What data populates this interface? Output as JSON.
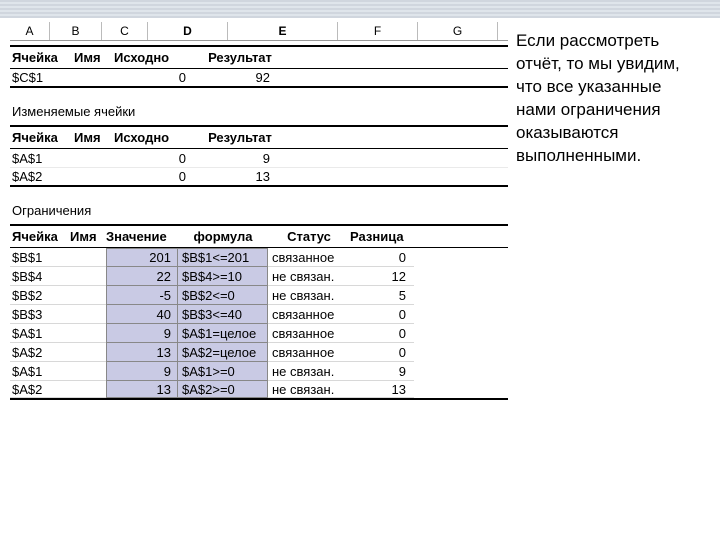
{
  "columns": {
    "a": "A",
    "b": "B",
    "c": "C",
    "d": "D",
    "e": "E",
    "f": "F",
    "g": "G"
  },
  "targetHeaders": {
    "cell": "Ячейка",
    "name": "Имя",
    "initial": "Исходно",
    "result": "Результат"
  },
  "targetRow": {
    "cell": "$C$1",
    "initial": "0",
    "result": "92"
  },
  "changingTitle": "Изменяемые ячейки",
  "changing": [
    {
      "cell": "$A$1",
      "initial": "0",
      "result": "9"
    },
    {
      "cell": "$A$2",
      "initial": "0",
      "result": "13"
    }
  ],
  "constraintsTitle": "Ограничения",
  "constraintHeaders": {
    "cell": "Ячейка",
    "name": "Имя",
    "value": "Значение",
    "formula": "формула",
    "status": "Статус",
    "diff": "Разница"
  },
  "constraints": [
    {
      "cell": "$B$1",
      "value": "201",
      "formula": "$B$1<=201",
      "status": "связанное",
      "diff": "0"
    },
    {
      "cell": "$B$4",
      "value": "22",
      "formula": "$B$4>=10",
      "status": "не связан.",
      "diff": "12"
    },
    {
      "cell": "$B$2",
      "value": "-5",
      "formula": "$B$2<=0",
      "status": "не связан.",
      "diff": "5"
    },
    {
      "cell": "$B$3",
      "value": "40",
      "formula": "$B$3<=40",
      "status": "связанное",
      "diff": "0"
    },
    {
      "cell": "$A$1",
      "value": "9",
      "formula": "$A$1=целое",
      "status": "связанное",
      "diff": "0"
    },
    {
      "cell": "$A$2",
      "value": "13",
      "formula": "$A$2=целое",
      "status": "связанное",
      "diff": "0"
    },
    {
      "cell": "$A$1",
      "value": "9",
      "formula": "$A$1>=0",
      "status": "не связан.",
      "diff": "9"
    },
    {
      "cell": "$A$2",
      "value": "13",
      "formula": "$A$2>=0",
      "status": "не связан.",
      "diff": "13"
    }
  ],
  "caption": "Если рассмотреть отчёт, то мы увидим, что все указанные нами ограничения оказываются выполненными."
}
